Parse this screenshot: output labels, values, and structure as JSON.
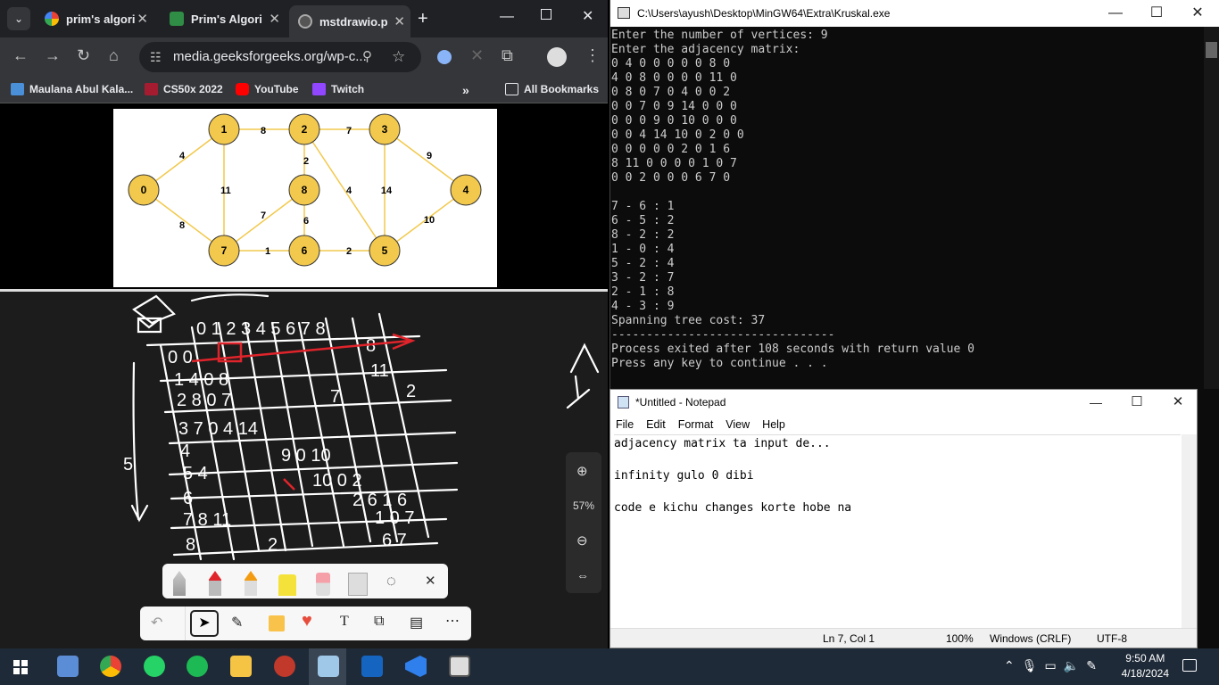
{
  "browser": {
    "tabs": [
      {
        "label": "prim's algori",
        "icon": "google-icon"
      },
      {
        "label": "Prim's Algori",
        "icon": "geeksforgeeks-icon"
      },
      {
        "label": "mstdrawio.p",
        "icon": "globe-icon"
      }
    ],
    "url": "media.geeksforgeeks.org/wp-c...",
    "bookmarks": [
      "Maulana Abul Kala...",
      "CS50x 2022",
      "YouTube",
      "Twitch"
    ],
    "all_bookmarks": "All Bookmarks"
  },
  "graph": {
    "nodes": [
      "0",
      "1",
      "2",
      "3",
      "4",
      "5",
      "6",
      "7",
      "8"
    ],
    "edge_labels": [
      "4",
      "8",
      "7",
      "9",
      "10",
      "14",
      "4",
      "2",
      "2",
      "1",
      "7",
      "6",
      "11",
      "8",
      "2"
    ]
  },
  "whiteboard": {
    "zoom_label": "57%"
  },
  "console": {
    "title": "C:\\Users\\ayush\\Desktop\\MinGW64\\Extra\\Kruskal.exe",
    "lines": [
      "Enter the number of vertices: 9",
      "Enter the adjacency matrix:",
      "0 4 0 0 0 0 0 8 0",
      "4 0 8 0 0 0 0 11 0",
      "0 8 0 7 0 4 0 0 2",
      "0 0 7 0 9 14 0 0 0",
      "0 0 0 9 0 10 0 0 0",
      "0 0 4 14 10 0 2 0 0",
      "0 0 0 0 0 2 0 1 6",
      "8 11 0 0 0 0 1 0 7",
      "0 0 2 0 0 0 6 7 0",
      "",
      "7 - 6 : 1",
      "6 - 5 : 2",
      "8 - 2 : 2",
      "1 - 0 : 4",
      "5 - 2 : 4",
      "3 - 2 : 7",
      "2 - 1 : 8",
      "4 - 3 : 9",
      "Spanning tree cost: 37",
      "--------------------------------",
      "Process exited after 108 seconds with return value 0",
      "Press any key to continue . . ."
    ]
  },
  "notepad": {
    "title": "*Untitled - Notepad",
    "menu": [
      "File",
      "Edit",
      "Format",
      "View",
      "Help"
    ],
    "text": "adjacency matrix ta input de...\n\ninfinity gulo 0 dibi\n\ncode e kichu changes korte hobe na",
    "status": {
      "position": "Ln 7, Col 1",
      "zoom": "100%",
      "line_ending": "Windows (CRLF)",
      "encoding": "UTF-8"
    }
  },
  "taskbar": {
    "time": "9:50 AM",
    "date": "4/18/2024"
  }
}
